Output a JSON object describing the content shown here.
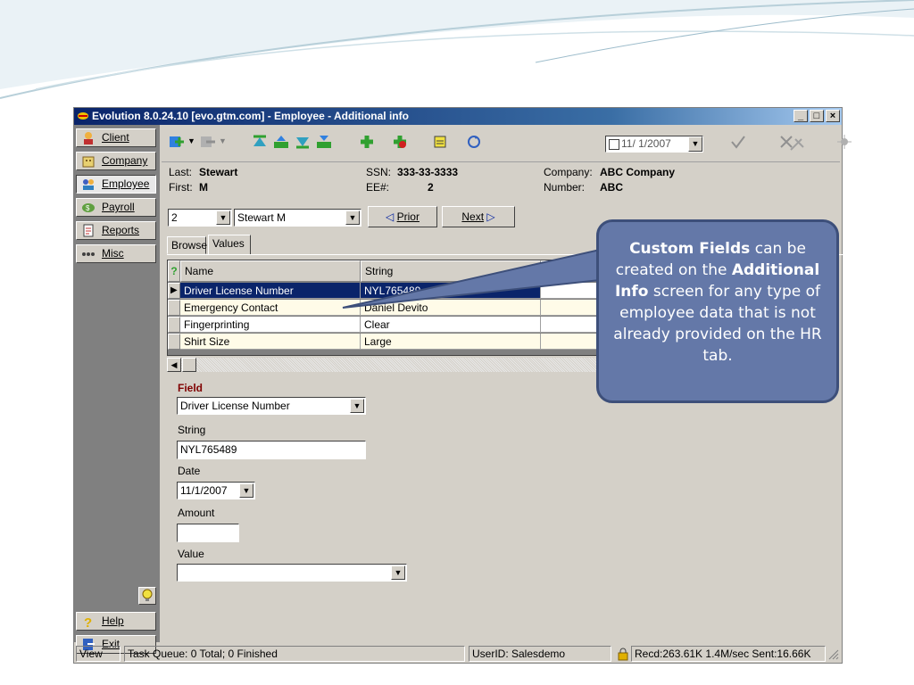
{
  "window": {
    "title": "Evolution 8.0.24.10 [evo.gtm.com] - Employee - Additional info",
    "min_label": "_",
    "max_label": "□",
    "close_label": "×"
  },
  "sidebar": {
    "items": [
      {
        "label": "Client",
        "icon": "client-icon"
      },
      {
        "label": "Company",
        "icon": "company-icon"
      },
      {
        "label": "Employee",
        "icon": "employee-icon",
        "active": true
      },
      {
        "label": "Payroll",
        "icon": "payroll-icon"
      },
      {
        "label": "Reports",
        "icon": "reports-icon"
      },
      {
        "label": "Misc",
        "icon": "misc-icon"
      }
    ],
    "help_label": "Help",
    "exit_label": "Exit"
  },
  "toolbar": {
    "date_value": "11/ 1/2007"
  },
  "employee": {
    "last_label": "Last:",
    "last_value": "Stewart",
    "first_label": "First:",
    "first_value": "M",
    "ssn_label": "SSN:",
    "ssn_value": "333-33-3333",
    "ee_label": "EE#:",
    "ee_value": "2",
    "company_label": "Company:",
    "company_value": "ABC Company",
    "number_label": "Number:",
    "number_value": "ABC"
  },
  "nav": {
    "ee_select": "2",
    "name_select": "Stewart M",
    "prior_label": "Prior",
    "next_label": "Next"
  },
  "tabs": [
    {
      "label": "Browse"
    },
    {
      "label": "Values",
      "selected": true
    }
  ],
  "grid": {
    "headers": [
      "Name",
      "String"
    ],
    "rows": [
      {
        "name": "Driver License Number",
        "string": "NYL765489",
        "selected": true
      },
      {
        "name": "Emergency Contact",
        "string": "Daniel Devito"
      },
      {
        "name": "Fingerprinting",
        "string": "Clear"
      },
      {
        "name": "Shirt Size",
        "string": "Large"
      }
    ]
  },
  "form": {
    "field_title": "Field",
    "field_value": "Driver License Number",
    "string_label": "String",
    "string_value": "NYL765489",
    "date_label": "Date",
    "date_value": "11/1/2007",
    "amount_label": "Amount",
    "amount_value": "",
    "value_label": "Value",
    "value_value": ""
  },
  "status": {
    "view": "View",
    "task": "Task Queue: 0 Total; 0 Finished",
    "user": "UserID: Salesdemo",
    "net": "Recd:263.61K 1.4M/sec  Sent:16.66K"
  },
  "callout": {
    "bold1": "Custom Fields",
    "text1": " can be created on the ",
    "bold2": "Additional Info",
    "text2": " screen for any type of employee data that is not already provided on the HR tab."
  },
  "colors": {
    "titlebar": "#0a246a",
    "panel": "#d4d0c8",
    "selection": "#0a246a",
    "callout": "#6478a8",
    "field_title": "#800000"
  }
}
